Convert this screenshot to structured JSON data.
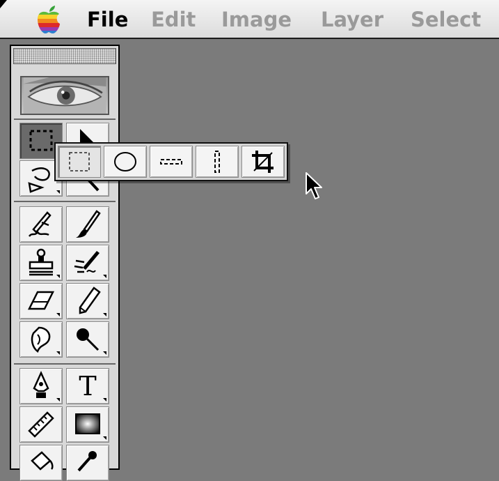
{
  "menubar": {
    "items": [
      "File",
      "Edit",
      "Image",
      "Layer",
      "Select"
    ],
    "enabled": [
      true,
      false,
      false,
      false,
      false
    ]
  },
  "palette": {
    "tools": [
      {
        "icon": "rectangular-marquee-icon",
        "active": true
      },
      {
        "icon": "move-icon"
      },
      {
        "icon": "lasso-icon"
      },
      {
        "icon": "magic-wand-icon"
      },
      {
        "icon": "airbrush-icon"
      },
      {
        "icon": "paintbrush-icon"
      },
      {
        "icon": "rubber-stamp-icon"
      },
      {
        "icon": "history-brush-icon"
      },
      {
        "icon": "eraser-icon"
      },
      {
        "icon": "pencil-icon"
      },
      {
        "icon": "blur-icon"
      },
      {
        "icon": "dodge-icon"
      },
      {
        "icon": "pen-icon"
      },
      {
        "icon": "type-icon",
        "letter": "T"
      },
      {
        "icon": "measure-icon"
      },
      {
        "icon": "gradient-icon"
      },
      {
        "icon": "paint-bucket-icon"
      },
      {
        "icon": "eyedropper-icon"
      }
    ]
  },
  "flyout": {
    "tools": [
      {
        "icon": "rectangular-marquee-icon",
        "selected": true
      },
      {
        "icon": "elliptical-marquee-icon"
      },
      {
        "icon": "single-row-marquee-icon"
      },
      {
        "icon": "single-column-marquee-icon"
      },
      {
        "icon": "crop-icon"
      }
    ]
  },
  "colors": {
    "desktop": "#7b7b7b",
    "menubar": "#e8e8e8",
    "menu_enabled": "#000000",
    "menu_disabled": "#9a9a9a",
    "palette": "#d8d8d8"
  }
}
